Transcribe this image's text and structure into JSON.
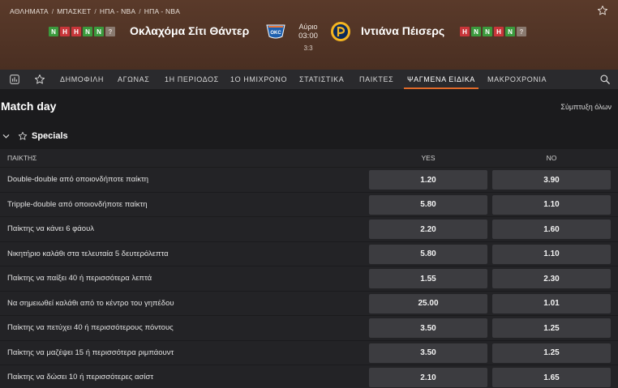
{
  "breadcrumb": [
    "ΑΘΛΗΜΑΤΑ",
    "ΜΠΑΣΚΕΤ",
    "ΗΠΑ - NBA",
    "ΗΠΑ - NBA"
  ],
  "match": {
    "home_team": "Οκλαχόμα Σίτι Θάντερ",
    "away_team": "Ιντιάνα Πέισερς",
    "day": "Αύριο",
    "time": "03:00",
    "score": "3:3",
    "home_form": [
      "W",
      "L",
      "L",
      "W",
      "W",
      "?"
    ],
    "home_form_labels": [
      "Ν",
      "Η",
      "Η",
      "Ν",
      "Ν",
      "?"
    ],
    "away_form_labels": [
      "Η",
      "Ν",
      "Ν",
      "Η",
      "Ν",
      "?"
    ],
    "away_form": [
      "L",
      "W",
      "W",
      "L",
      "W",
      "?"
    ]
  },
  "tabs": [
    "ΔΗΜΟΦΙΛΗ",
    "ΑΓΩΝΑΣ",
    "1Η ΠΕΡΙΟΔΟΣ",
    "1Ο ΗΜΙΧΡΟΝΟ",
    "ΣΤΑΤΙΣΤΙΚΑ",
    "ΠΑΙΚΤΕΣ",
    "ΨΑΓΜΕΝΑ ΕΙΔΙΚΑ",
    "ΜΑΚΡΟΧΡΟΝΙΑ"
  ],
  "active_tab": "ΨΑΓΜΕΝΑ ΕΙΔΙΚΑ",
  "page": {
    "title": "Match day",
    "collapse_all": "Σύμπτυξη όλων"
  },
  "section": {
    "title": "Specials",
    "col_player": "ΠΑΙΚΤΗΣ",
    "col_yes": "YES",
    "col_no": "NO"
  },
  "markets": [
    {
      "label": "Double-double από οποιονδήποτε παίκτη",
      "yes": "1.20",
      "no": "3.90"
    },
    {
      "label": "Tripple-double από οποιονδήποτε παίκτη",
      "yes": "5.80",
      "no": "1.10"
    },
    {
      "label": "Παίκτης να κάνει 6 φάουλ",
      "yes": "2.20",
      "no": "1.60"
    },
    {
      "label": "Νικητήριο καλάθι στα τελευταία 5 δευτερόλεπτα",
      "yes": "5.80",
      "no": "1.10"
    },
    {
      "label": "Παίκτης να παίξει 40 ή περισσότερα λεπτά",
      "yes": "1.55",
      "no": "2.30"
    },
    {
      "label": "Να σημειωθεί καλάθι από το κέντρο του γηπέδου",
      "yes": "25.00",
      "no": "1.01"
    },
    {
      "label": "Παίκτης να πετύχει 40 ή περισσότερους πόντους",
      "yes": "3.50",
      "no": "1.25"
    },
    {
      "label": "Παίκτης να μαζέψει 15 ή περισσότερα ριμπάουντ",
      "yes": "3.50",
      "no": "1.25"
    },
    {
      "label": "Παίκτης να δώσει 10 ή περισσότερες ασίστ",
      "yes": "2.10",
      "no": "1.65"
    }
  ],
  "colors": {
    "header_brown": "#5a3a2a",
    "accent_orange": "#e06a2a",
    "win_green": "#3b9a3d",
    "loss_red": "#c8363a"
  }
}
